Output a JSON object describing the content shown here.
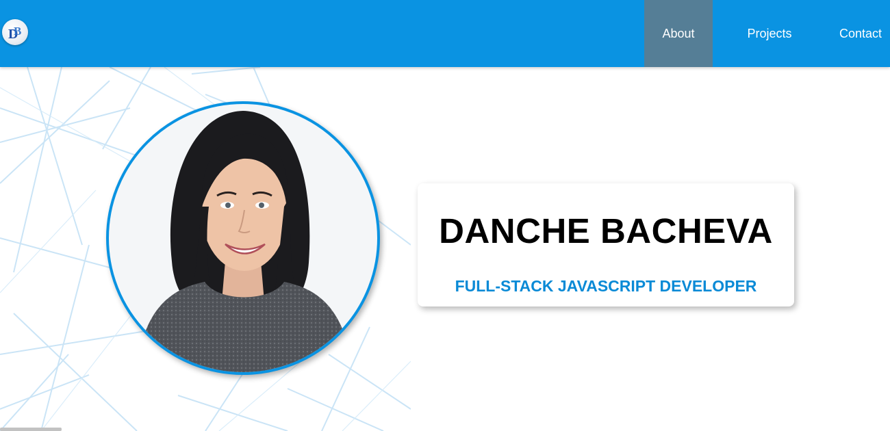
{
  "navbar": {
    "logo_text": "DB",
    "background": "#0a93e2",
    "active_background": "#557e96",
    "items": [
      {
        "label": "About",
        "active": true
      },
      {
        "label": "Projects",
        "active": false
      },
      {
        "label": "Contact",
        "active": false
      }
    ]
  },
  "hero": {
    "name": "DANCHE BACHEVA",
    "role": "FULL-STACK JAVASCRIPT DEVELOPER",
    "accent_color": "#0a93e2",
    "portrait_icon": "profile-photo"
  }
}
